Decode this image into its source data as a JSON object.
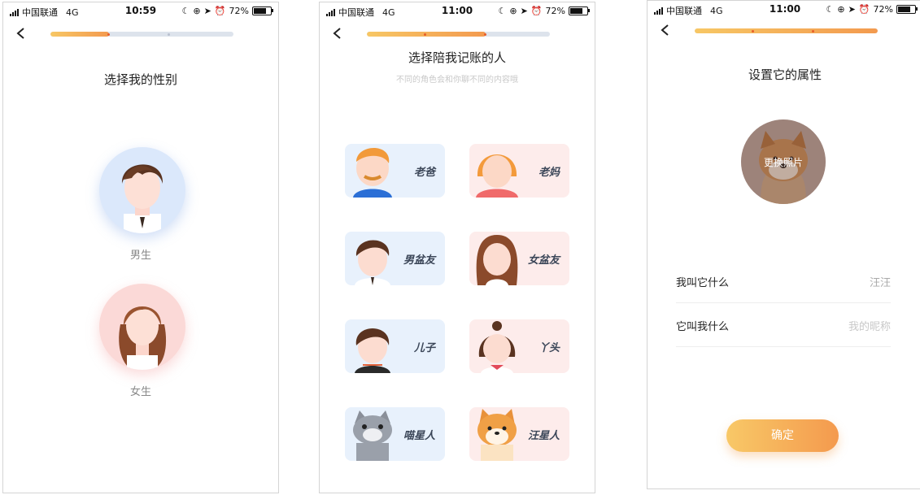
{
  "status": [
    {
      "carrier": "中国联通",
      "network": "4G",
      "time": "10:59",
      "battery": "72%"
    },
    {
      "carrier": "中国联通",
      "network": "4G",
      "time": "11:00",
      "battery": "72%"
    },
    {
      "carrier": "中国联通",
      "network": "4G",
      "time": "11:00",
      "battery": "72%"
    }
  ],
  "progress": [
    0.32,
    0.65,
    1.0
  ],
  "screen1": {
    "title": "选择我的性别",
    "options": [
      {
        "label": "男生"
      },
      {
        "label": "女生"
      }
    ]
  },
  "screen2": {
    "title": "选择陪我记账的人",
    "subtitle": "不同的角色会和你聊不同的内容哦",
    "characters": [
      {
        "label": "老爸",
        "theme": "blue",
        "icon": "dad-avatar-icon"
      },
      {
        "label": "老妈",
        "theme": "pink",
        "icon": "mom-avatar-icon"
      },
      {
        "label": "男盆友",
        "theme": "blue",
        "icon": "boyfriend-avatar-icon"
      },
      {
        "label": "女盆友",
        "theme": "pink",
        "icon": "girlfriend-avatar-icon"
      },
      {
        "label": "儿子",
        "theme": "blue",
        "icon": "son-avatar-icon"
      },
      {
        "label": "丫头",
        "theme": "pink",
        "icon": "daughter-avatar-icon"
      },
      {
        "label": "喵星人",
        "theme": "blue",
        "icon": "cat-avatar-icon"
      },
      {
        "label": "汪星人",
        "theme": "pink",
        "icon": "dog-avatar-icon"
      }
    ]
  },
  "screen3": {
    "title": "设置它的属性",
    "photo_label": "更换照片",
    "fields": [
      {
        "label": "我叫它什么",
        "value": "汪汪",
        "placeholder": false
      },
      {
        "label": "它叫我什么",
        "value": "我的昵称",
        "placeholder": true
      }
    ],
    "confirm": "确定"
  },
  "colors": {
    "accent_start": "#f8c867",
    "accent_end": "#f49a4e",
    "track": "#dde3ec",
    "card_blue": "#e8f1fc",
    "card_pink": "#fdeceb"
  }
}
